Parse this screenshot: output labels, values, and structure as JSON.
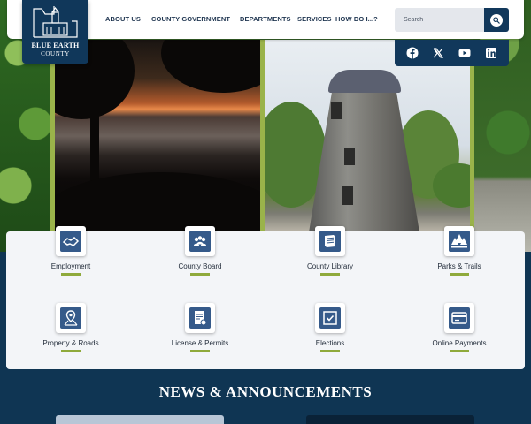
{
  "brand": {
    "name": "BLUE EARTH",
    "subtitle": "COUNTY"
  },
  "nav": {
    "items": [
      {
        "label": "ABOUT US"
      },
      {
        "label": "COUNTY GOVERNMENT"
      },
      {
        "label": "DEPARTMENTS"
      },
      {
        "label": "SERVICES"
      },
      {
        "label": "HOW DO I...?"
      }
    ]
  },
  "search": {
    "placeholder": "Search",
    "icon": "search-icon"
  },
  "social": [
    {
      "icon": "facebook-icon"
    },
    {
      "icon": "x-icon"
    },
    {
      "icon": "youtube-icon"
    },
    {
      "icon": "linkedin-icon"
    }
  ],
  "quick_links": [
    {
      "label": "Employment",
      "icon": "handshake-icon"
    },
    {
      "label": "County Board",
      "icon": "people-icon"
    },
    {
      "label": "County Library",
      "icon": "book-icon"
    },
    {
      "label": "Parks & Trails",
      "icon": "trees-icon"
    },
    {
      "label": "Property & Roads",
      "icon": "map-pin-icon"
    },
    {
      "label": "License & Permits",
      "icon": "document-icon"
    },
    {
      "label": "Elections",
      "icon": "ballot-check-icon"
    },
    {
      "label": "Online Payments",
      "icon": "payment-icon"
    }
  ],
  "news": {
    "title": "NEWS & ANNOUNCEMENTS"
  },
  "colors": {
    "navy": "#11385b",
    "accent_green": "#8faa3c",
    "icon_blue": "#355a8a"
  }
}
